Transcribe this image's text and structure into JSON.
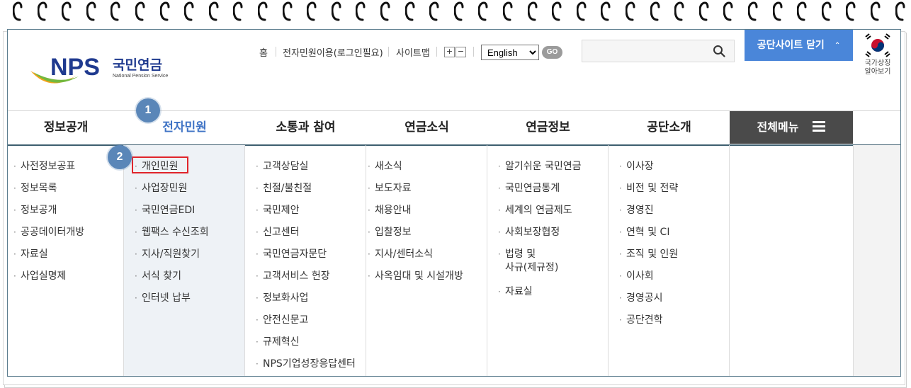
{
  "header": {
    "logo": {
      "brand": "NPS",
      "name_kr": "국민연금",
      "name_en": "National Pension Service"
    },
    "util_links": [
      "홈",
      "전자민원이용(로그인필요)",
      "사이트맵"
    ],
    "zoom_in": "+",
    "zoom_out": "−",
    "language": {
      "selected": "English"
    },
    "go_label": "GO",
    "search": {
      "value": "",
      "placeholder": ""
    },
    "close_site_label": "공단사이트 닫기",
    "symbol_label_1": "국가상징",
    "symbol_label_2": "알아보기"
  },
  "gnb": {
    "items": [
      "정보공개",
      "전자민원",
      "소통과 참여",
      "연금소식",
      "연금정보",
      "공단소개"
    ],
    "active_index": 1,
    "all_menu_label": "전체메뉴"
  },
  "columns": [
    [
      "사전정보공표",
      "정보목록",
      "정보공개",
      "공공데이터개방",
      "자료실",
      "사업실명제"
    ],
    [
      "개인민원",
      "사업장민원",
      "국민연금EDI",
      "웹팩스 수신조회",
      "지사/직원찾기",
      "서식 찾기",
      "인터넷 납부"
    ],
    [
      "고객상담실",
      "친절/불친절",
      "국민제안",
      "신고센터",
      "국민연금자문단",
      "고객서비스 헌장",
      "정보화사업",
      "안전신문고",
      "규제혁신",
      "NPS기업성장응답센터"
    ],
    [
      "새소식",
      "보도자료",
      "채용안내",
      "입찰정보",
      "지사/센터소식",
      "사옥임대 및 시설개방"
    ],
    [
      "알기쉬운 국민연금",
      "국민연금통계",
      "세계의 연금제도",
      "사회보장협정",
      "법령 및",
      "사규(제규정)",
      "자료실"
    ],
    [
      "이사장",
      "비전 및 전략",
      "경영진",
      "연혁 및 CI",
      "조직 및 인원",
      "이사회",
      "경영공시",
      "공단견학"
    ]
  ],
  "badges": [
    "1",
    "2"
  ],
  "colors": {
    "accent": "#4a86d9",
    "active": "#3f73c5",
    "badge": "#5a86b8",
    "highlight": "#e0242b",
    "allmenu_bg": "#4a4a4a"
  }
}
